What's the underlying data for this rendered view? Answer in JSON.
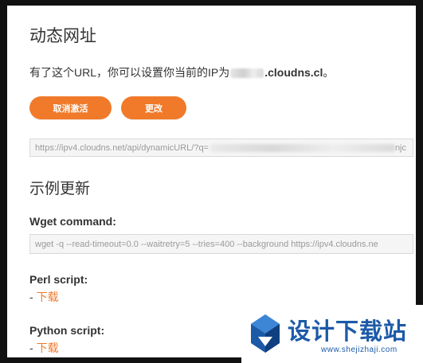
{
  "page": {
    "title": "动态网址",
    "description_prefix": "有了这个URL，你可以设置你当前的IP为",
    "description_domain": ".cloudns.cl",
    "description_suffix": "。"
  },
  "buttons": {
    "cancel_activation": "取消激活",
    "change": "更改"
  },
  "dynamic_url": {
    "visible_text": "https://ipv4.cloudns.net/api/dynamicURL/?q=",
    "tail_text": "njc"
  },
  "examples": {
    "title": "示例更新",
    "wget_label": "Wget command:",
    "wget_command": "wget -q --read-timeout=0.0 --waitretry=5 --tries=400 --background https://ipv4.cloudns.ne",
    "perl_label": "Perl script:",
    "perl_download": "下载",
    "python_label": "Python script:",
    "python_download": "下载",
    "dash": "-"
  },
  "watermark": {
    "logo_text": "设计下载站",
    "url": "www.shejizhaji.com"
  },
  "colors": {
    "accent": "#f07a2a",
    "watermark_blue": "#1c5aa8"
  }
}
